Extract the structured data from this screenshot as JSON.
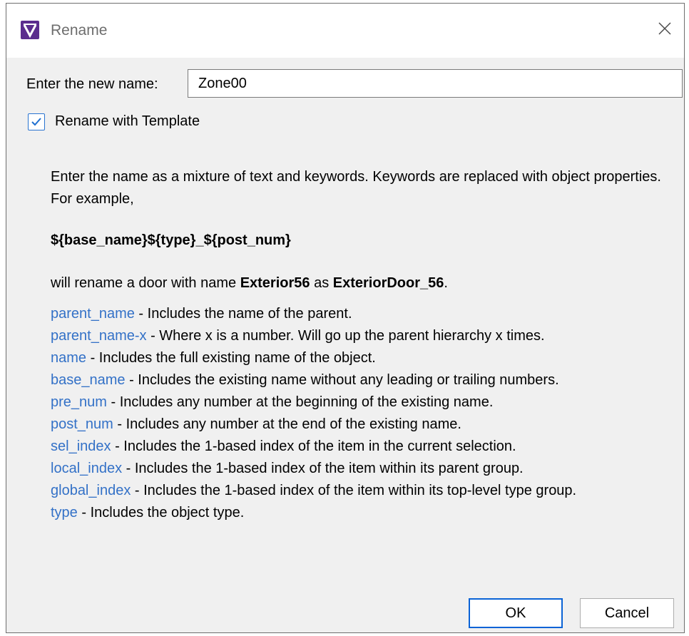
{
  "window": {
    "title": "Rename",
    "app_icon": "v-logo-icon",
    "close_icon": "close-icon"
  },
  "name_field": {
    "label": "Enter the new name:",
    "value": "Zone00"
  },
  "template_option": {
    "label": "Rename with Template",
    "checked": true
  },
  "help": {
    "intro": "Enter the name as a mixture of text and keywords. Keywords are replaced with object properties. For example,",
    "template_example": "${base_name}${type}_${post_num}",
    "example_prefix": "will rename a door with name ",
    "example_old": "Exterior56",
    "example_mid": " as ",
    "example_new": "ExteriorDoor_56",
    "example_suffix": ".",
    "keywords": [
      {
        "key": "parent_name",
        "desc": " - Includes the name of the parent."
      },
      {
        "key": "parent_name-x",
        "desc": " - Where x is a number. Will go up the parent hierarchy x times."
      },
      {
        "key": "name",
        "desc": " - Includes the full existing name of the object."
      },
      {
        "key": "base_name",
        "desc": " - Includes the existing name without any leading or trailing numbers."
      },
      {
        "key": "pre_num",
        "desc": " - Includes any number at the beginning of the existing name."
      },
      {
        "key": "post_num",
        "desc": " - Includes any number at the end of the existing name."
      },
      {
        "key": "sel_index",
        "desc": " - Includes the 1-based index of the item in the current selection."
      },
      {
        "key": "local_index",
        "desc": " - Includes the 1-based index of the item within its parent group."
      },
      {
        "key": "global_index",
        "desc": " - Includes the 1-based index of the item within its top-level type group."
      },
      {
        "key": "type",
        "desc": " - Includes the object type."
      }
    ]
  },
  "buttons": {
    "ok": "OK",
    "cancel": "Cancel"
  },
  "colors": {
    "keyword": "#3371c7",
    "accent": "#0a63d6",
    "app_icon_bg": "#5b2d8e"
  }
}
